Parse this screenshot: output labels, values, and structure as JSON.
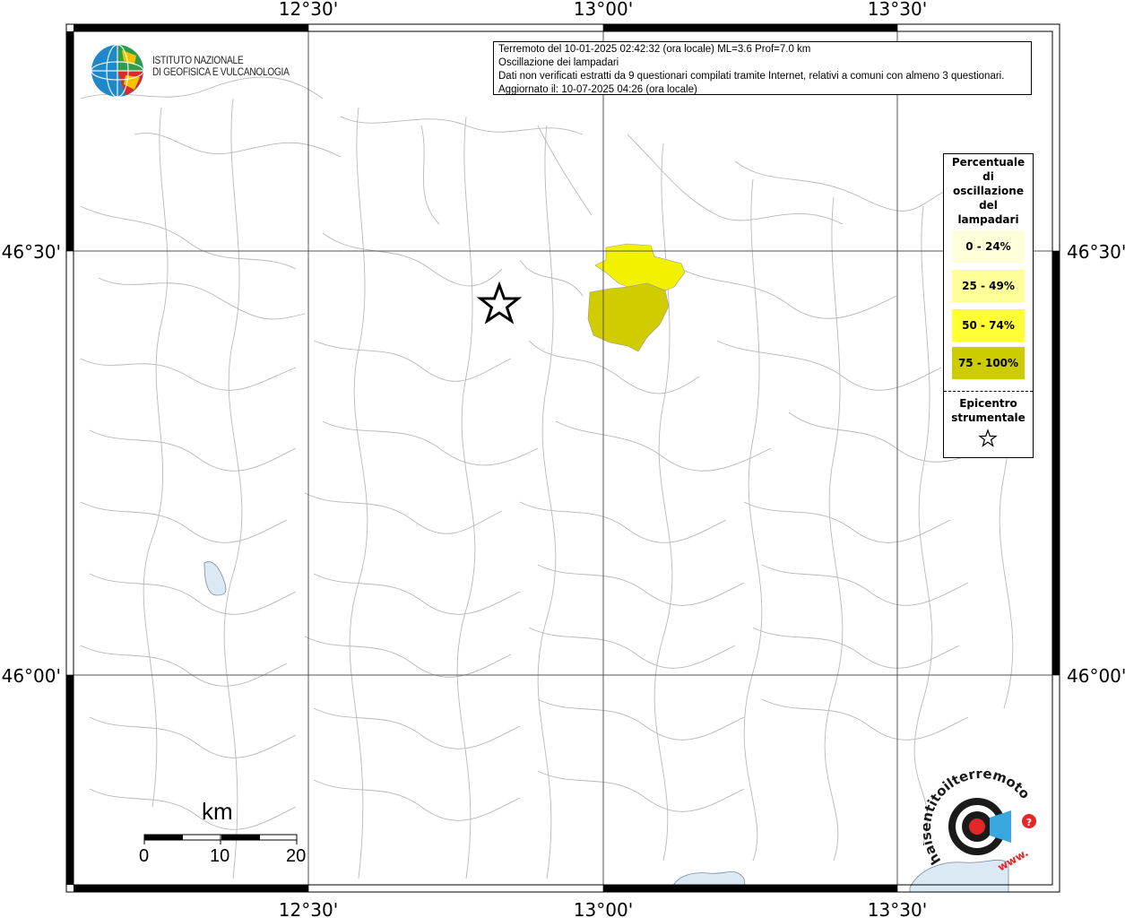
{
  "info_box": {
    "line1": "Terremoto del 10-01-2025 02:42:32 (ora locale) ML=3.6 Prof=7.0 km",
    "line2": "Oscillazione dei lampadari",
    "line3": "Dati non verificati estratti da 9 questionari compilati tramite Internet, relativi a comuni con almeno 3 questionari.",
    "line4": "Aggiornato il: 10-07-2025 04:26 (ora locale)"
  },
  "ingv_logo": {
    "line1": "ISTITUTO NAZIONALE",
    "line2": "DI GEOFISICA E VULCANOLOGIA"
  },
  "axes": {
    "lon_labels": [
      "12°30'",
      "13°00'",
      "13°30'"
    ],
    "lat_labels": [
      "46°30'",
      "46°00'"
    ]
  },
  "legend": {
    "title_lines": [
      "Percentuale",
      "di",
      "oscillazione",
      "del",
      "lampadari"
    ],
    "classes": [
      {
        "label": "0 - 24%",
        "color": "#ffffd9"
      },
      {
        "label": "25 - 49%",
        "color": "#ffff99"
      },
      {
        "label": "50 - 74%",
        "color": "#ffff33"
      },
      {
        "label": "75 - 100%",
        "color": "#cccc00"
      }
    ],
    "epicenter_lines": [
      "Epicentro",
      "strumentale"
    ]
  },
  "scale_bar": {
    "unit": "km",
    "ticks": [
      "0",
      "10",
      "20"
    ]
  },
  "hst_logo": {
    "text": "haisentitoilterremoto.it",
    "prefix": "www."
  },
  "colors": {
    "class_50_74": "#f2f200",
    "class_75_100": "#d0cc00",
    "lake": "#dbe9f5",
    "borders": "#b8b8b8",
    "grid": "#555555"
  }
}
